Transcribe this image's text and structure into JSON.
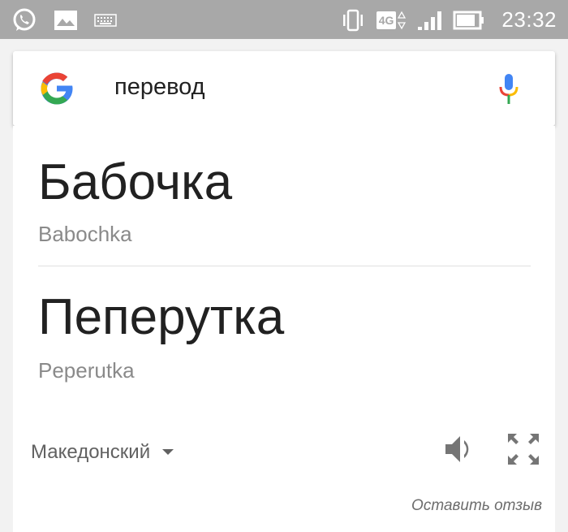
{
  "status_bar": {
    "left_icons": [
      "whatsapp-icon",
      "image-icon",
      "keyboard-icon"
    ],
    "right_icons": [
      "vibrate-icon",
      "network-4g-icon",
      "signal-icon",
      "battery-icon"
    ],
    "network_type": "4G",
    "time": "23:32"
  },
  "search": {
    "query": "перевод",
    "logo_icon": "google-g-icon",
    "mic_icon": "microphone-icon"
  },
  "translation": {
    "source_word": "Бабочка",
    "source_transliteration": "Babochka",
    "target_word": "Пеперутка",
    "target_transliteration": "Peperutka",
    "target_language": "Македонский",
    "speaker_icon": "speaker-icon",
    "expand_icon": "fullscreen-icon",
    "feedback_link": "Оставить отзыв"
  },
  "colors": {
    "status_bar": "#a8a8a8",
    "page_background": "#f2f2f2",
    "primary_text": "#212121",
    "secondary_text": "#8a8a8a",
    "google_blue": "#4285f4",
    "google_red": "#ea4335",
    "google_yellow": "#fbbc05",
    "google_green": "#34a853"
  }
}
